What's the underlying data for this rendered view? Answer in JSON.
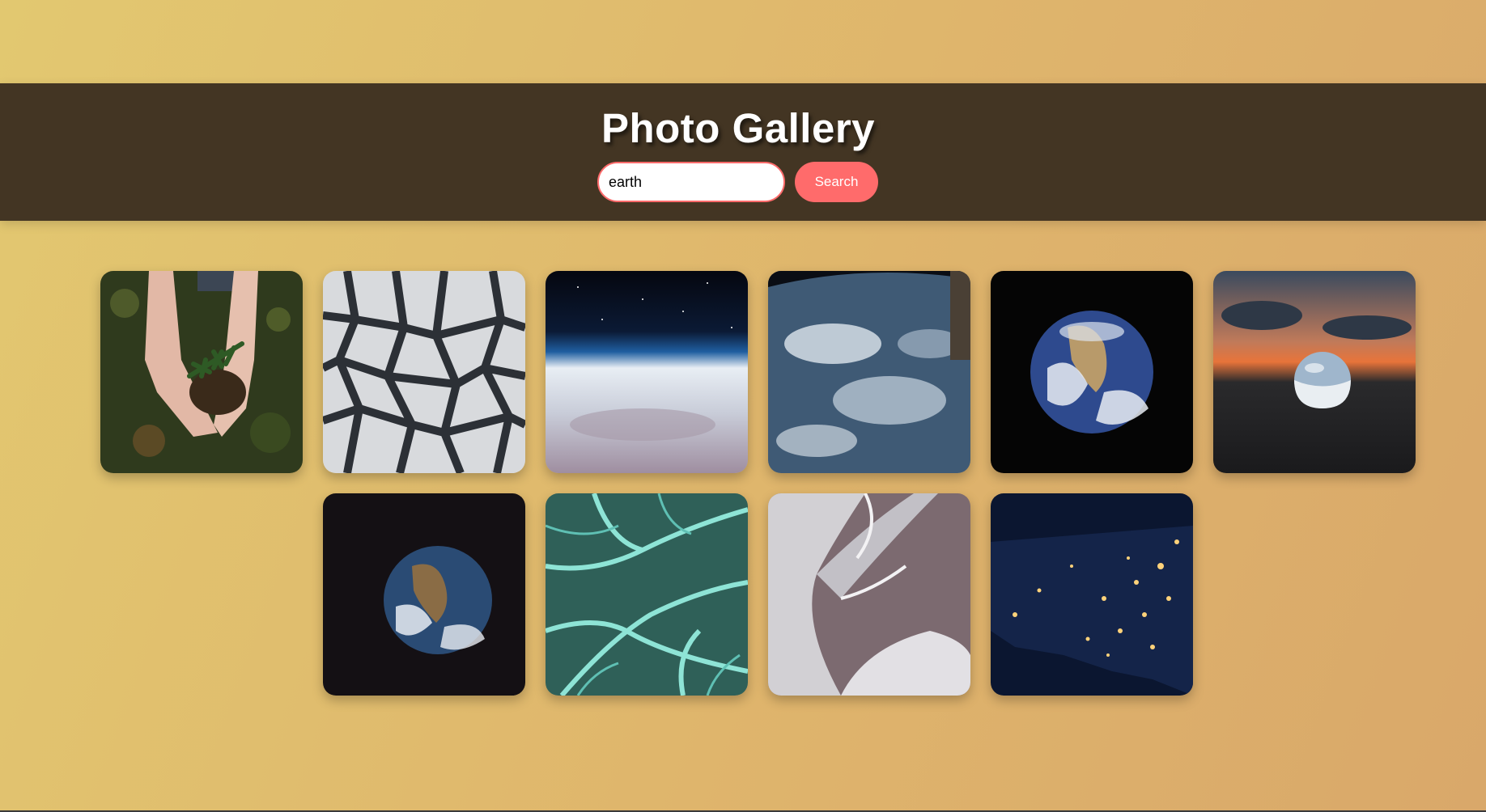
{
  "page": {
    "title": "Photo Gallery"
  },
  "search": {
    "value": "earth",
    "button_label": "Search"
  },
  "gallery": {
    "photos": [
      {
        "icon": "hands-holding-fern-photo"
      },
      {
        "icon": "cracked-dry-earth-photo"
      },
      {
        "icon": "earth-horizon-from-space-photo"
      },
      {
        "icon": "earth-from-space-station-photo"
      },
      {
        "icon": "blue-marble-earth-photo"
      },
      {
        "icon": "crystal-ball-sunset-photo"
      },
      {
        "icon": "earth-globe-dark-photo"
      },
      {
        "icon": "teal-river-delta-aerial-photo"
      },
      {
        "icon": "glacier-riverbed-aerial-photo"
      },
      {
        "icon": "usa-night-lights-photo"
      }
    ]
  }
}
